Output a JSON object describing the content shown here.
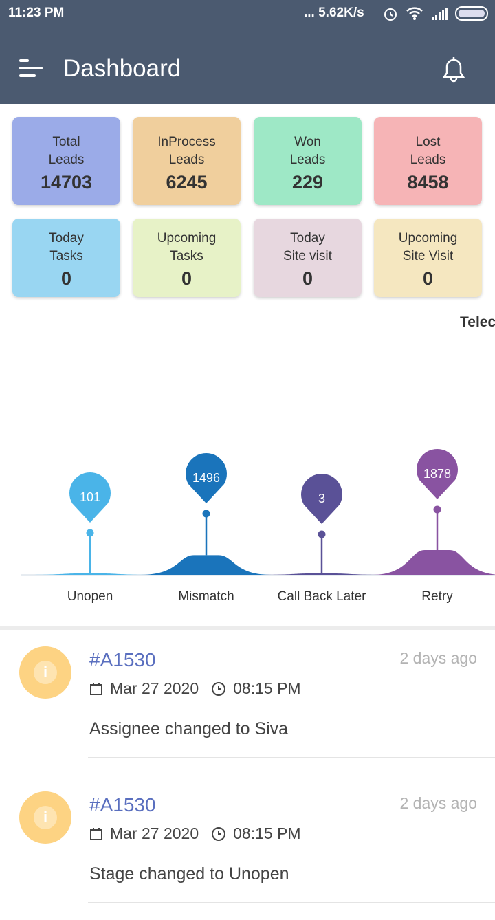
{
  "status_bar": {
    "time": "11:23 PM",
    "speed": "... 5.62K/s"
  },
  "header": {
    "title": "Dashboard"
  },
  "cards": [
    {
      "line1": "Total",
      "line2": "Leads",
      "value": "14703",
      "color": "#9babe8"
    },
    {
      "line1": "InProcess",
      "line2": "Leads",
      "value": "6245",
      "color": "#f0cf9d"
    },
    {
      "line1": "Won",
      "line2": "Leads",
      "value": "229",
      "color": "#9ee8c6"
    },
    {
      "line1": "Lost",
      "line2": "Leads",
      "value": "8458",
      "color": "#f6b4b6"
    },
    {
      "line1": "Today",
      "line2": "Tasks",
      "value": "0",
      "color": "#99d6f2"
    },
    {
      "line1": "Upcoming",
      "line2": "Tasks",
      "value": "0",
      "color": "#e7f2c7"
    },
    {
      "line1": "Today",
      "line2": "Site visit",
      "value": "0",
      "color": "#e7d7df"
    },
    {
      "line1": "Upcoming",
      "line2": "Site Visit",
      "value": "0",
      "color": "#f5e7c0"
    }
  ],
  "chart_section": {
    "heading": "Telec"
  },
  "chart_data": {
    "type": "area",
    "categories": [
      "Unopen",
      "Mismatch",
      "Call Back Later",
      "Retry"
    ],
    "values": [
      101,
      1496,
      3,
      1878
    ],
    "colors": [
      "#4ab4e8",
      "#1a74bb",
      "#5a5197",
      "#8953a1"
    ]
  },
  "activity": [
    {
      "id": "#A1530",
      "ago": "2 days ago",
      "date": "Mar 27 2020",
      "time": "08:15 PM",
      "message": "Assignee changed to Siva"
    },
    {
      "id": "#A1530",
      "ago": "2 days ago",
      "date": "Mar 27 2020",
      "time": "08:15 PM",
      "message": "Stage changed to Unopen"
    }
  ]
}
